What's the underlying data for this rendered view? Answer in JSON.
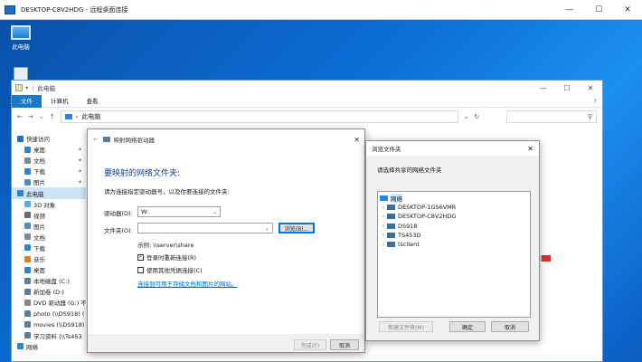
{
  "rdp": {
    "title": "DESKTOP-C8V2HDG - 远程桌面连接",
    "min": "—",
    "max": "☐",
    "close": "✕"
  },
  "desktop": {
    "this_pc_label": "此电脑"
  },
  "explorer": {
    "title": "此电脑",
    "ribbon_tabs": [
      "文件",
      "计算机",
      "查看"
    ],
    "help": "?",
    "address": "此电脑",
    "nav_items": [
      {
        "label": "快速访问",
        "indent": 0,
        "pin": false,
        "color": "#1e6fc9"
      },
      {
        "label": "桌面",
        "indent": 1,
        "pin": true,
        "color": "#2a86d8"
      },
      {
        "label": "文档",
        "indent": 1,
        "pin": true,
        "color": "#7a8a9a"
      },
      {
        "label": "下载",
        "indent": 1,
        "pin": true,
        "color": "#2a86d8"
      },
      {
        "label": "图片",
        "indent": 1,
        "pin": true,
        "color": "#4f8fc6"
      },
      {
        "label": "此电脑",
        "indent": 0,
        "pin": false,
        "color": "#2a86d8",
        "selected": true
      },
      {
        "label": "3D 对象",
        "indent": 1,
        "pin": false,
        "color": "#4fb0e6"
      },
      {
        "label": "视频",
        "indent": 1,
        "pin": false,
        "color": "#6a6a6a"
      },
      {
        "label": "图片",
        "indent": 1,
        "pin": false,
        "color": "#4f8fc6"
      },
      {
        "label": "文档",
        "indent": 1,
        "pin": false,
        "color": "#7a8a9a"
      },
      {
        "label": "下载",
        "indent": 1,
        "pin": false,
        "color": "#2a86d8"
      },
      {
        "label": "音乐",
        "indent": 1,
        "pin": false,
        "color": "#e67a1e"
      },
      {
        "label": "桌面",
        "indent": 1,
        "pin": false,
        "color": "#2a86d8"
      },
      {
        "label": "本地磁盘 (C:)",
        "indent": 1,
        "pin": false,
        "color": "#5c7e9e"
      },
      {
        "label": "新加卷 (D:)",
        "indent": 1,
        "pin": false,
        "color": "#5c7e9e"
      },
      {
        "label": "DVD 驱动器 (G:) 不",
        "indent": 1,
        "pin": false,
        "color": "#888888"
      },
      {
        "label": "photo (\\\\DS918) (",
        "indent": 1,
        "pin": false,
        "color": "#5c7e9e"
      },
      {
        "label": "movies (\\\\DS918) (",
        "indent": 1,
        "pin": false,
        "color": "#5c7e9e"
      },
      {
        "label": "学习资料 (\\\\Ts453",
        "indent": 1,
        "pin": false,
        "color": "#5c7e9e"
      },
      {
        "label": "网络",
        "indent": 0,
        "pin": false,
        "color": "#2a86d8"
      }
    ]
  },
  "map_dialog": {
    "title": "映射网络驱动器",
    "heading": "要映射的网络文件夹:",
    "description": "请为连接指定驱动器号，以及你要连接的文件夹:",
    "drive_label": "驱动器(D):",
    "drive_value": "W:",
    "folder_label": "文件夹(O):",
    "folder_value": "",
    "browse_button": "浏览(B)...",
    "example": "示例: \\\\server\\share",
    "reconnect_label": "登录时重新连接(R)",
    "reconnect_checked": true,
    "other_creds_label": "使用其他凭据连接(C)",
    "other_creds_checked": false,
    "link": "连接到可用于存储文档和图片的网站。",
    "finish_button": "完成(F)",
    "cancel_button": "取消"
  },
  "browse_dialog": {
    "title": "浏览文件夹",
    "prompt": "请选择共享的网络文件夹",
    "tree": [
      {
        "label": "网络",
        "level": 0,
        "expandable": false,
        "selected": true
      },
      {
        "label": "DESKTOP-1GS6VMR",
        "level": 1,
        "expandable": true
      },
      {
        "label": "DESKTOP-C8V2HDG",
        "level": 1,
        "expandable": true
      },
      {
        "label": "DS918",
        "level": 1,
        "expandable": true
      },
      {
        "label": "TS453D",
        "level": 1,
        "expandable": true
      },
      {
        "label": "tsclient",
        "level": 1,
        "expandable": true
      }
    ],
    "new_folder_button": "新建文件夹(M)",
    "ok_button": "确定",
    "cancel_button": "取消"
  }
}
